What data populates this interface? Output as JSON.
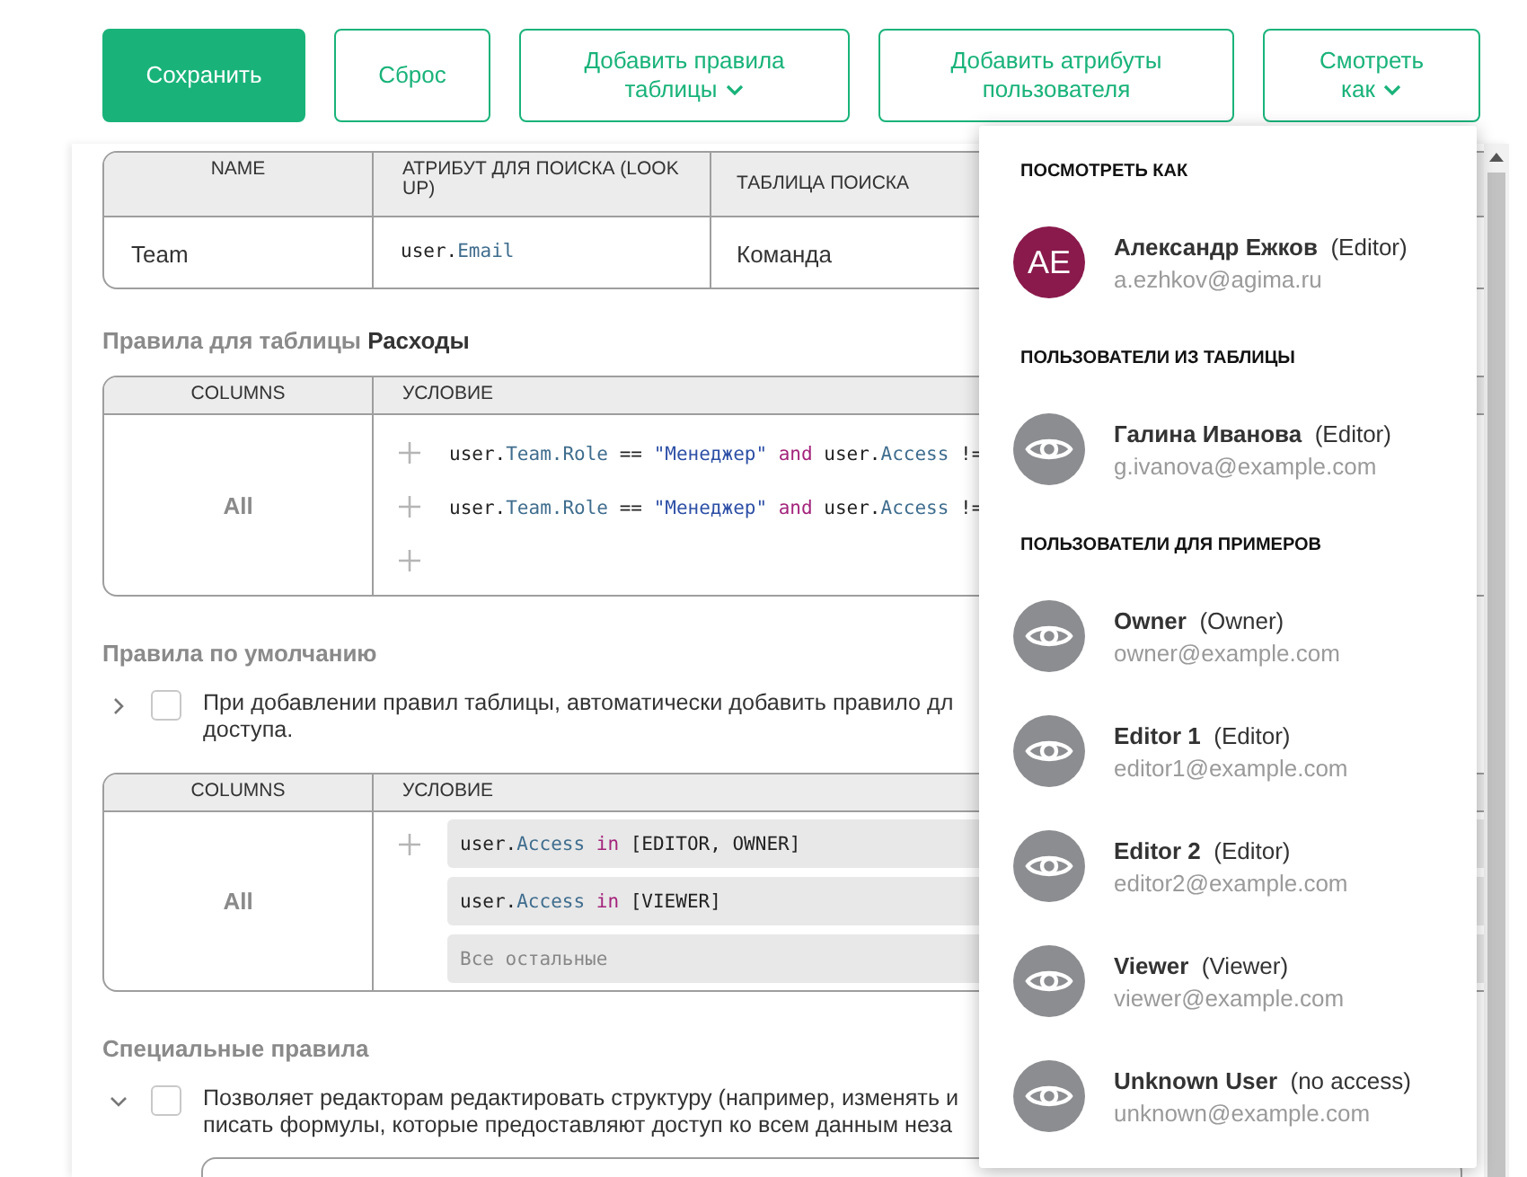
{
  "toolbar": [
    {
      "label": "Сохранить",
      "kind": "primary",
      "dropdown": false
    },
    {
      "label": "Сброс",
      "kind": "outline",
      "dropdown": false
    },
    {
      "label": "Добавить правила таблицы",
      "kind": "outline",
      "dropdown": true
    },
    {
      "label": "Добавить атрибуты пользователя",
      "kind": "outline",
      "dropdown": false
    },
    {
      "label": "Смотреть как",
      "kind": "outline",
      "dropdown": true
    }
  ],
  "attributes_table": {
    "columns": [
      "NAME",
      "АТРИБУТ ДЛЯ ПОИСКА (LOOK UP)",
      "ТАБЛИЦА ПОИСКА"
    ],
    "rows": [
      {
        "name": "Team",
        "lookup": [
          {
            "kind": "plain",
            "text": "user."
          },
          {
            "kind": "prop",
            "text": "Email"
          }
        ],
        "table": "Команда"
      }
    ]
  },
  "table_rules": {
    "heading": "Правила для таблицы **Расходы**",
    "columns": [
      "COLUMNS",
      "УСЛОВИЕ"
    ],
    "scope": "All",
    "rows": [
      {
        "add": true,
        "code": [
          {
            "kind": "plain",
            "text": "user."
          },
          {
            "kind": "prop",
            "text": "Team.Role"
          },
          {
            "kind": "plain",
            "text": " == "
          },
          {
            "kind": "str",
            "text": "\"Менеджер\""
          },
          {
            "kind": "kw",
            "text": " and"
          },
          {
            "kind": "plain",
            "text": " user."
          },
          {
            "kind": "prop",
            "text": "Access"
          },
          {
            "kind": "plain",
            "text": " !="
          }
        ]
      },
      {
        "add": true,
        "code": [
          {
            "kind": "plain",
            "text": "user."
          },
          {
            "kind": "prop",
            "text": "Team.Role"
          },
          {
            "kind": "plain",
            "text": " == "
          },
          {
            "kind": "str",
            "text": "\"Менеджер\""
          },
          {
            "kind": "kw",
            "text": " and"
          },
          {
            "kind": "plain",
            "text": " user."
          },
          {
            "kind": "prop",
            "text": "Access"
          },
          {
            "kind": "plain",
            "text": " !="
          }
        ]
      },
      {
        "add": true,
        "code": []
      }
    ]
  },
  "default_rules": {
    "heading": "Правила по умолчанию",
    "option": {
      "expanded": false,
      "checked": false,
      "lines": [
        "При добавлении правил таблицы, автоматически добавить правило дл",
        "доступа."
      ]
    },
    "columns": [
      "COLUMNS",
      "УСЛОВИЕ"
    ],
    "scope": "All",
    "rows": [
      {
        "add": true,
        "code": [
          {
            "kind": "plain",
            "text": "user."
          },
          {
            "kind": "prop",
            "text": "Access"
          },
          {
            "kind": "kw",
            "text": " in"
          },
          {
            "kind": "plain",
            "text": " [EDITOR, OWNER]"
          }
        ]
      },
      {
        "add": false,
        "code": [
          {
            "kind": "plain",
            "text": "user."
          },
          {
            "kind": "prop",
            "text": "Access"
          },
          {
            "kind": "kw",
            "text": " in"
          },
          {
            "kind": "plain",
            "text": " [VIEWER]"
          }
        ]
      },
      {
        "add": false,
        "placeholder": "Все остальные",
        "code": []
      }
    ]
  },
  "special_rules": {
    "heading": "Специальные правила",
    "option": {
      "expanded": true,
      "checked": false,
      "lines": [
        "Позволяет редакторам редактировать структуру (например, изменять и",
        "писать формулы, которые предоставляют доступ ко всем данным неза"
      ]
    }
  },
  "view_as_menu": {
    "sections": [
      {
        "title": "ПОСМОТРЕТЬ КАК",
        "users": [
          {
            "name": "Александр Ежков",
            "role": "(Editor)",
            "email": "a.ezhkov@agima.ru",
            "avatar": {
              "kind": "initials",
              "initials": "AE",
              "color": "#8a1a4c"
            }
          }
        ]
      },
      {
        "title": "ПОЛЬЗОВАТЕЛИ ИЗ ТАБЛИЦЫ",
        "users": [
          {
            "name": "Галина Иванова",
            "role": "(Editor)",
            "email": "g.ivanova@example.com",
            "avatar": {
              "kind": "eye"
            }
          }
        ]
      },
      {
        "title": "ПОЛЬЗОВАТЕЛИ ДЛЯ ПРИМЕРОВ",
        "users": [
          {
            "name": "Owner",
            "role": "(Owner)",
            "email": "owner@example.com",
            "avatar": {
              "kind": "eye"
            }
          },
          {
            "name": "Editor 1",
            "role": "(Editor)",
            "email": "editor1@example.com",
            "avatar": {
              "kind": "eye"
            }
          },
          {
            "name": "Editor 2",
            "role": "(Editor)",
            "email": "editor2@example.com",
            "avatar": {
              "kind": "eye"
            }
          },
          {
            "name": "Viewer",
            "role": "(Viewer)",
            "email": "viewer@example.com",
            "avatar": {
              "kind": "eye"
            }
          },
          {
            "name": "Unknown User",
            "role": "(no access)",
            "email": "unknown@example.com",
            "avatar": {
              "kind": "eye"
            }
          }
        ]
      }
    ]
  }
}
